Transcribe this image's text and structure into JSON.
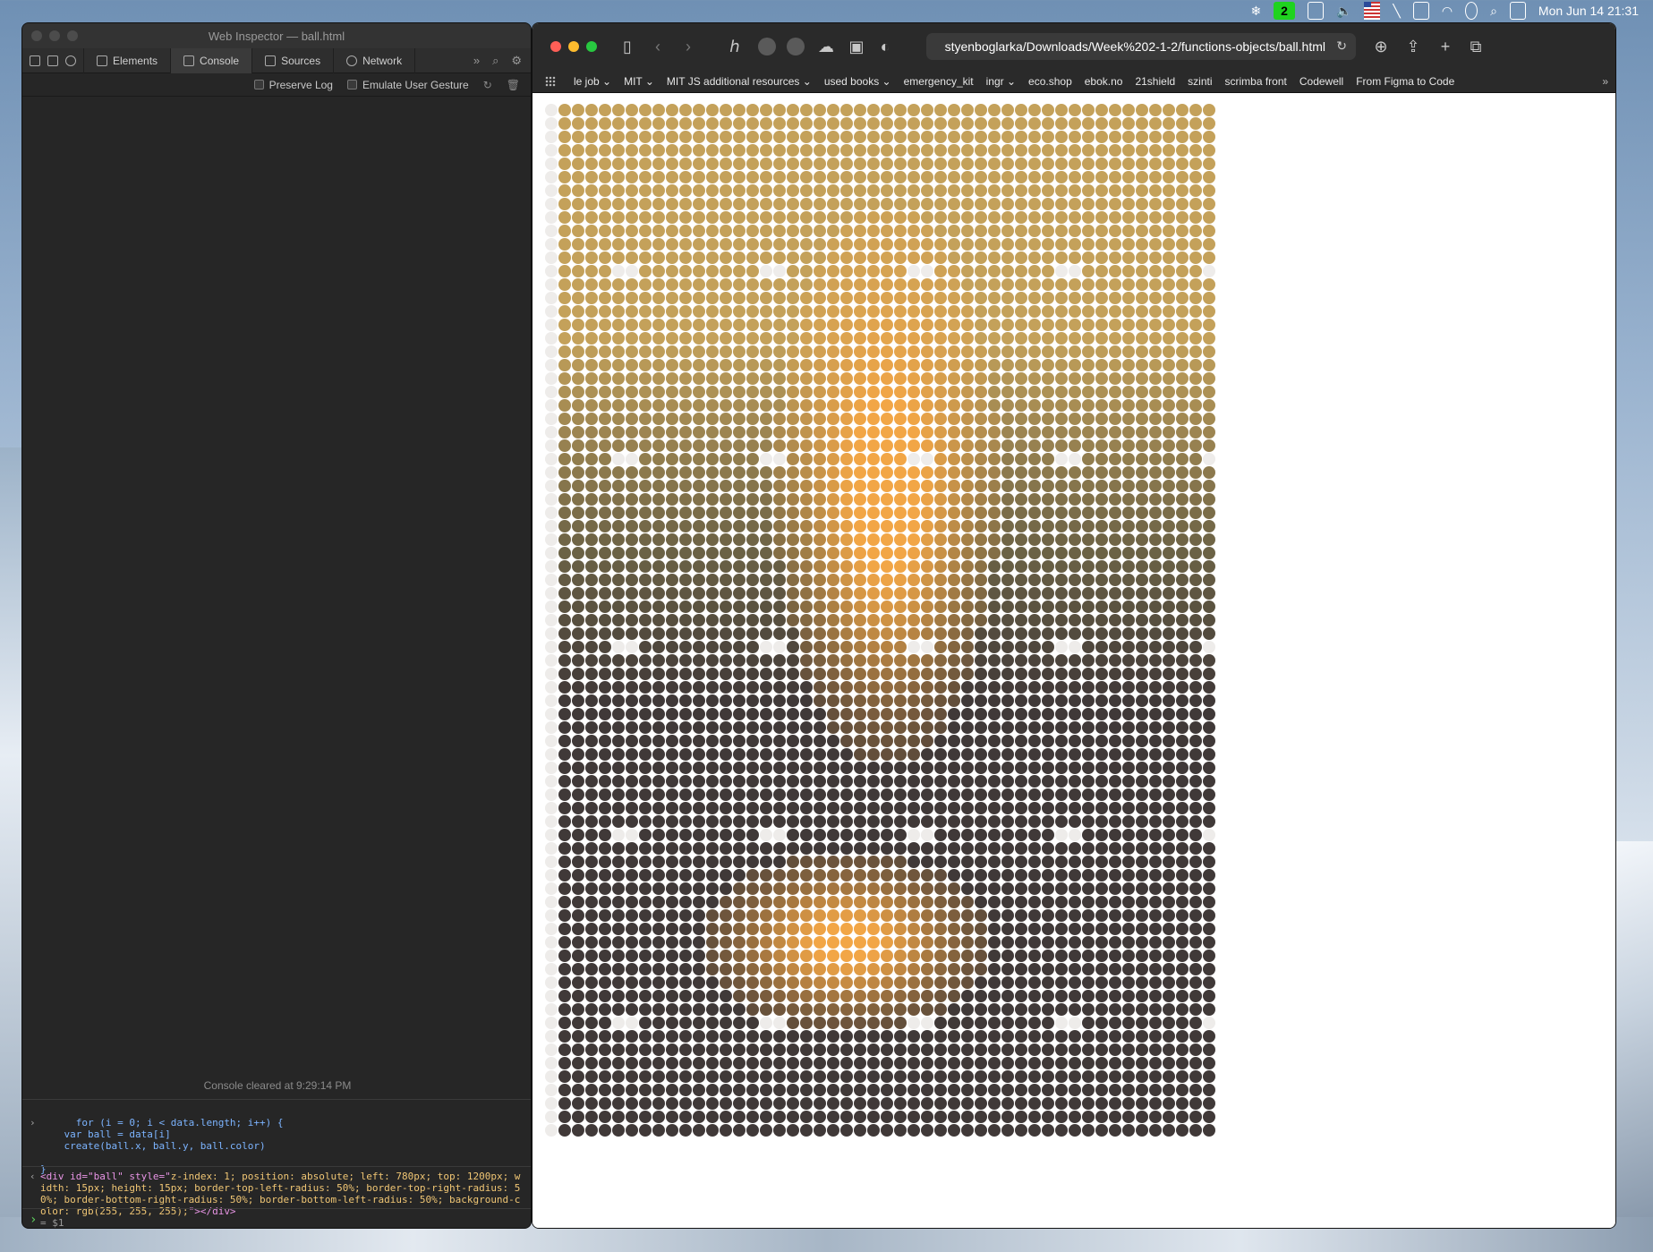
{
  "menubar": {
    "badge": "2",
    "datetime": "Mon Jun 14  21:31"
  },
  "inspector": {
    "title": "Web Inspector — ball.html",
    "tabs": [
      {
        "label": "Elements"
      },
      {
        "label": "Console"
      },
      {
        "label": "Sources"
      },
      {
        "label": "Network"
      }
    ],
    "active_tab": "Console",
    "options": {
      "preserve_log": "Preserve Log",
      "emulate_gesture": "Emulate User Gesture"
    },
    "cleared_message": "Console cleared at 9:29:14 PM",
    "input_code": "for (i = 0; i < data.length; i++) {\n    var ball = data[i]\n    create(ball.x, ball.y, ball.color)\n\n}",
    "output": {
      "open_tag": "<div id=\"ball\" style=\"",
      "style": "z-index: 1; position: absolute; left: 780px; top: 1200px; width: 15px; height: 15px; border-top-left-radius: 50%; border-top-right-radius: 50%; border-bottom-right-radius: 50%; border-bottom-left-radius: 50%; background-color: rgb(255, 255, 255);",
      "close_tag": "\"></div>",
      "return_ref": "= $1"
    }
  },
  "safari": {
    "url": "styenboglarka/Downloads/Week%202-1-2/functions-objects/ball.html",
    "bookmarks": [
      "le job ⌄",
      "MIT ⌄",
      "MIT JS additional resources ⌄",
      "used books ⌄",
      "emergency_kit",
      "ingr ⌄",
      "eco.shop",
      "ebok.no",
      "21shield",
      "szinti",
      "scrimba front",
      "Codewell",
      "From Figma to Code"
    ]
  },
  "colors": {
    "accent_green": "#1fd31f",
    "gold": "#c4a15a",
    "dark": "#403938",
    "skin": "#f2a646"
  }
}
